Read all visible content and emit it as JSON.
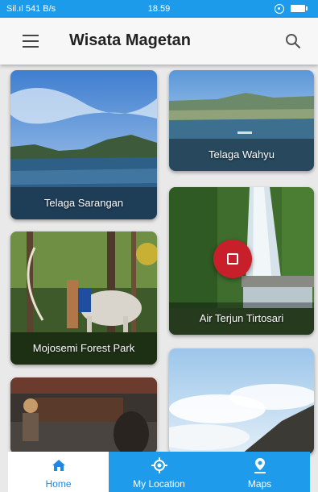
{
  "status_bar": {
    "left_text": "Sil.ıl 541 B/s",
    "time": "18.59"
  },
  "app_bar": {
    "title": "Wisata Magetan",
    "menu_icon": "hamburger-menu-icon",
    "search_icon": "search-icon"
  },
  "destinations": [
    {
      "name": "Telaga Sarangan"
    },
    {
      "name": "Telaga Wahyu"
    },
    {
      "name": "Mojosemi Forest Park"
    },
    {
      "name": "Air Terjun Tirtosari"
    },
    {
      "name": ""
    },
    {
      "name": ""
    }
  ],
  "bottom_nav": {
    "items": [
      {
        "label": "Home",
        "icon": "home-icon",
        "active": true
      },
      {
        "label": "My Location",
        "icon": "my-location-icon",
        "active": false
      },
      {
        "label": "Maps",
        "icon": "map-pin-icon",
        "active": false
      }
    ]
  },
  "colors": {
    "primary": "#1e9bea",
    "fab": "#c8202a",
    "active_nav_text": "#1e88e5"
  }
}
